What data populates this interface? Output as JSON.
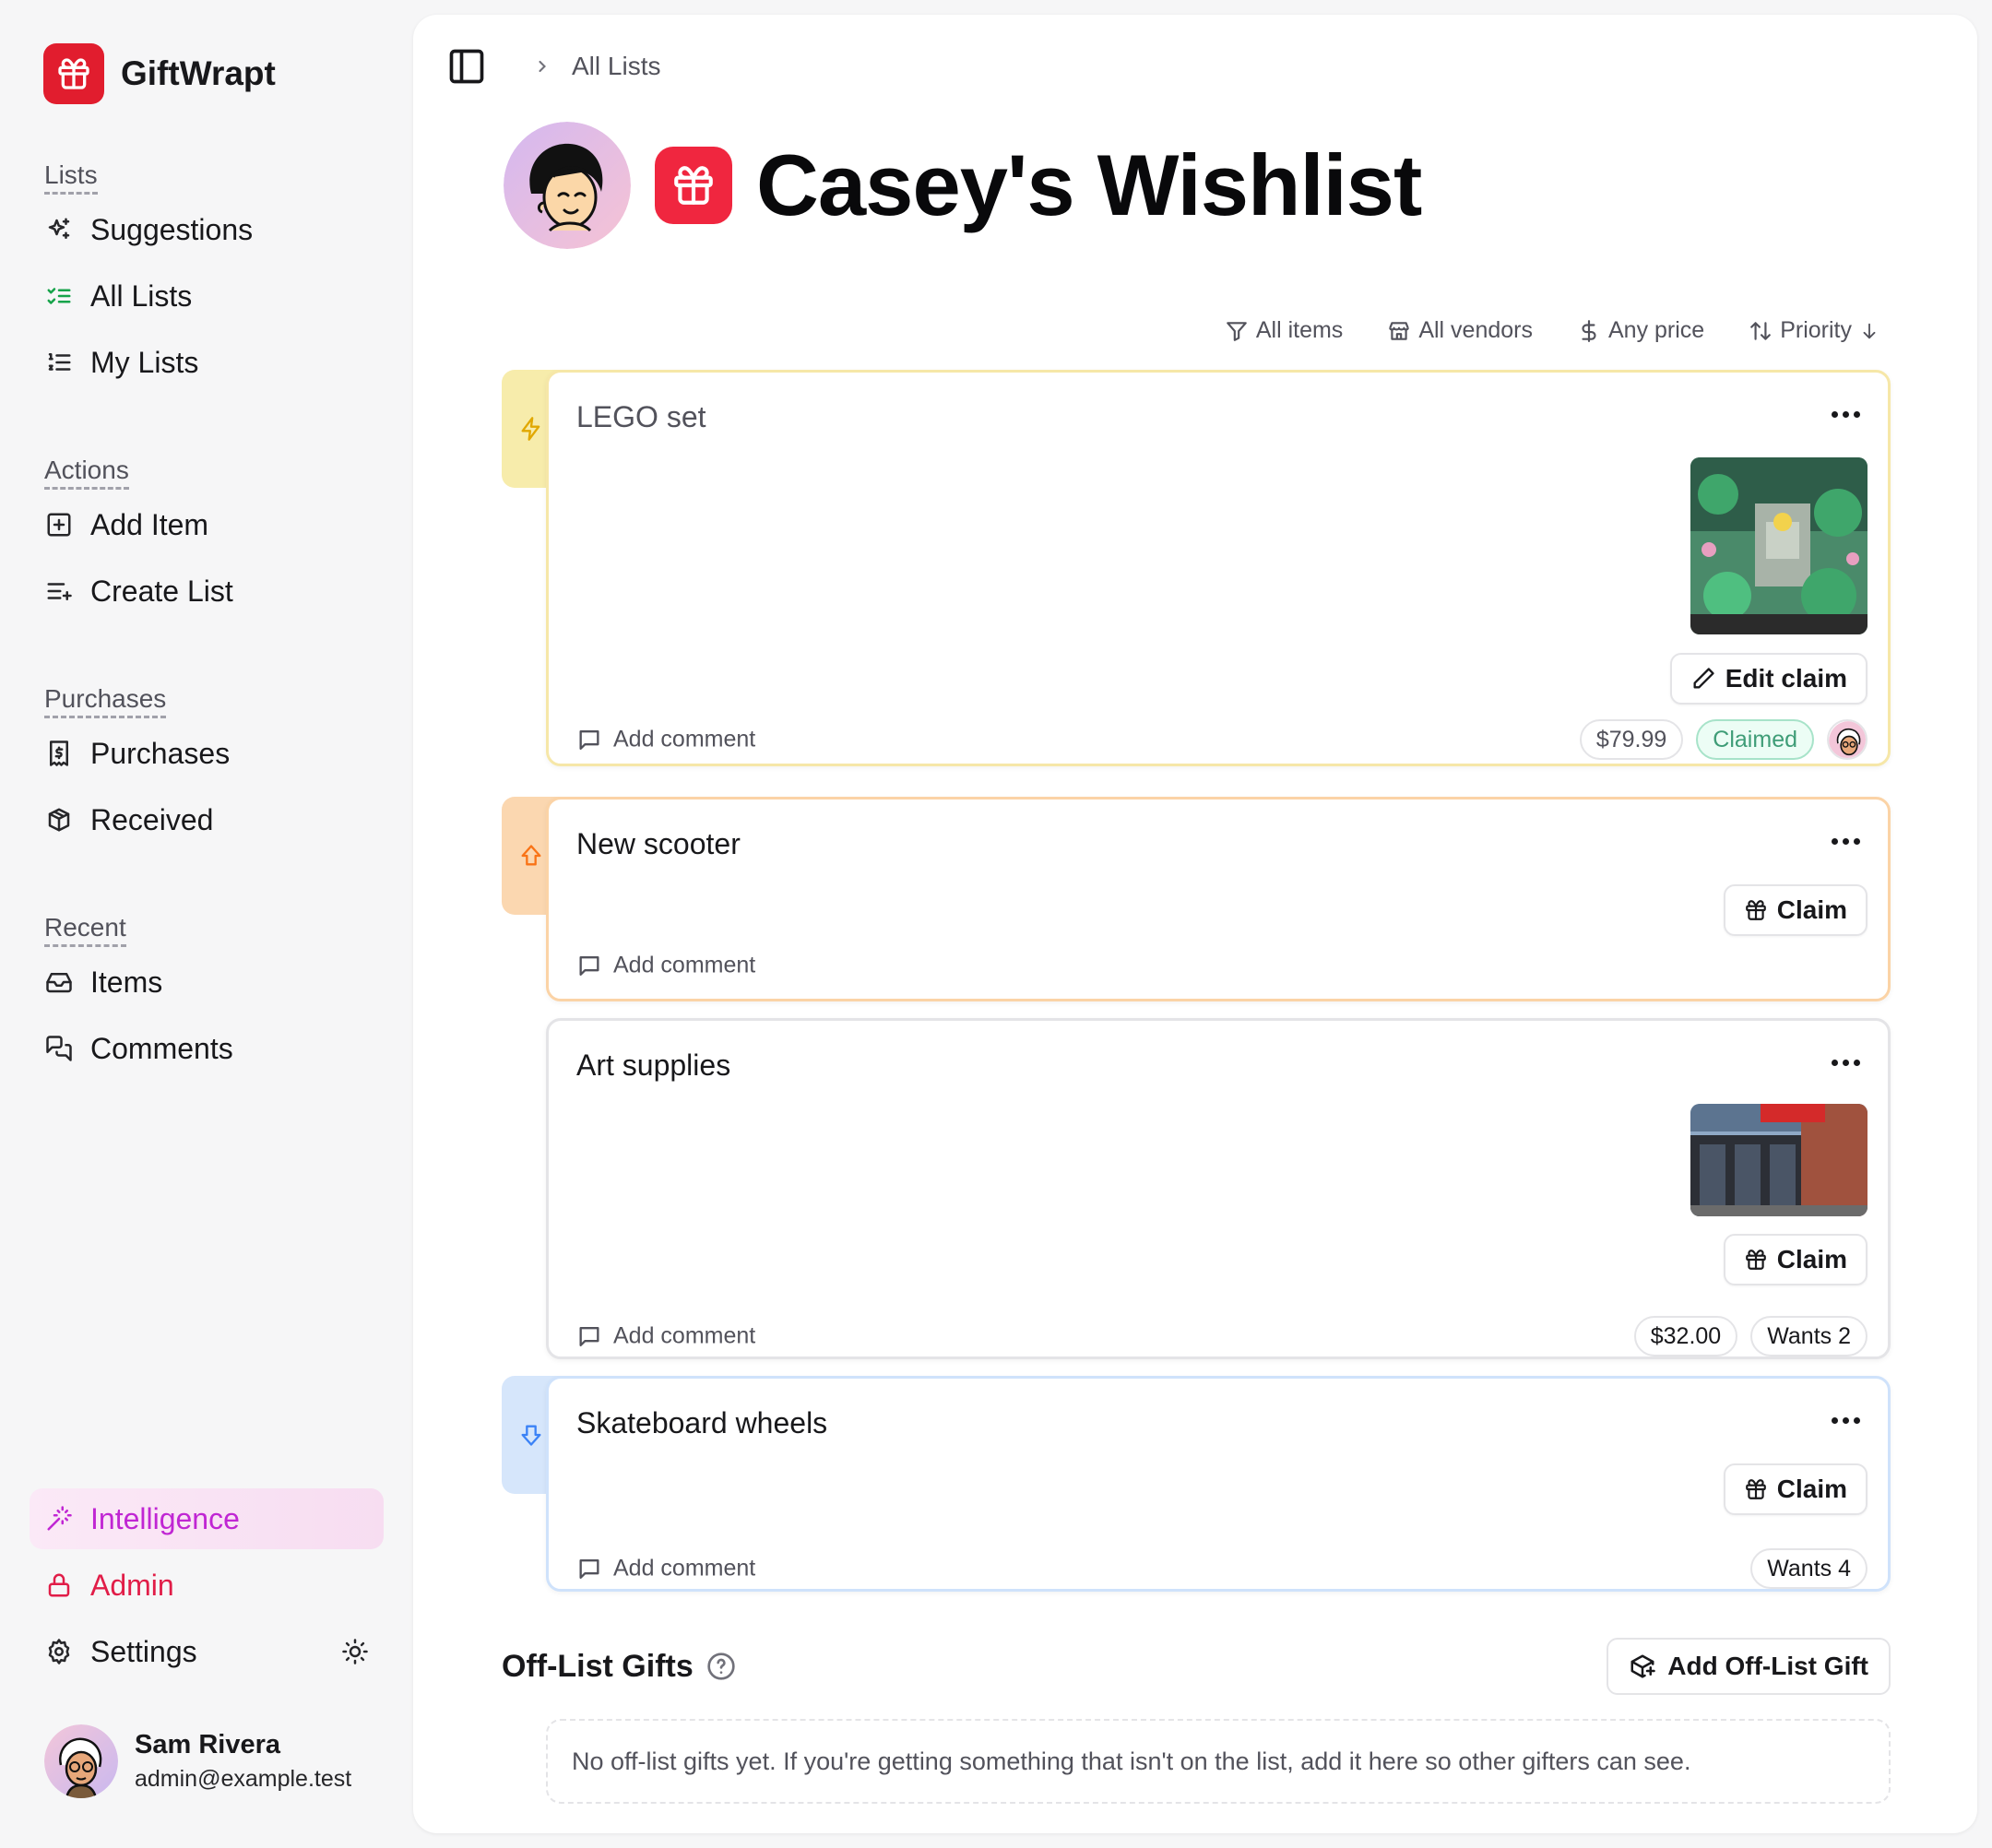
{
  "app": {
    "name": "GiftWrapt"
  },
  "sidebar": {
    "sections": [
      {
        "title": "Lists",
        "items": [
          {
            "label": "Suggestions",
            "icon": "sparkles-icon"
          },
          {
            "label": "All Lists",
            "icon": "list-checks-icon"
          },
          {
            "label": "My Lists",
            "icon": "list-ordered-icon"
          }
        ]
      },
      {
        "title": "Actions",
        "items": [
          {
            "label": "Add Item",
            "icon": "plus-square-icon"
          },
          {
            "label": "Create List",
            "icon": "list-plus-icon"
          }
        ]
      },
      {
        "title": "Purchases",
        "items": [
          {
            "label": "Purchases",
            "icon": "receipt-icon"
          },
          {
            "label": "Received",
            "icon": "package-icon"
          }
        ]
      },
      {
        "title": "Recent",
        "items": [
          {
            "label": "Items",
            "icon": "inbox-icon"
          },
          {
            "label": "Comments",
            "icon": "messages-icon"
          }
        ]
      }
    ],
    "bottom": {
      "intelligence": "Intelligence",
      "admin": "Admin",
      "settings": "Settings"
    },
    "user": {
      "name": "Sam Rivera",
      "email": "admin@example.test"
    }
  },
  "breadcrumb": {
    "current": "All Lists"
  },
  "list": {
    "title": "Casey's Wishlist"
  },
  "filters": {
    "items": "All items",
    "vendors": "All vendors",
    "price": "Any price",
    "sort": "Priority"
  },
  "items": [
    {
      "title": "LEGO set",
      "priority": "very-high",
      "price": "$79.99",
      "status": "Claimed",
      "action": "Edit claim",
      "comment": "Add comment"
    },
    {
      "title": "New scooter",
      "priority": "high",
      "action": "Claim",
      "comment": "Add comment"
    },
    {
      "title": "Art supplies",
      "priority": "normal",
      "price": "$32.00",
      "wants": "Wants 2",
      "action": "Claim",
      "comment": "Add comment"
    },
    {
      "title": "Skateboard wheels",
      "priority": "low",
      "wants": "Wants 4",
      "action": "Claim",
      "comment": "Add comment"
    }
  ],
  "offlist": {
    "title": "Off-List Gifts",
    "add_label": "Add Off-List Gift",
    "empty": "No off-list gifts yet. If you're getting something that isn't on the list, add it here so other gifters can see."
  },
  "colors": {
    "brand": "#e11d2e",
    "priority_very_high": "#f5e9a0",
    "priority_high": "#fbd3a6",
    "priority_low": "#cfe2fb",
    "claimed": "#3f9d77",
    "intelligence": "#c026d3",
    "admin": "#e11d48"
  }
}
